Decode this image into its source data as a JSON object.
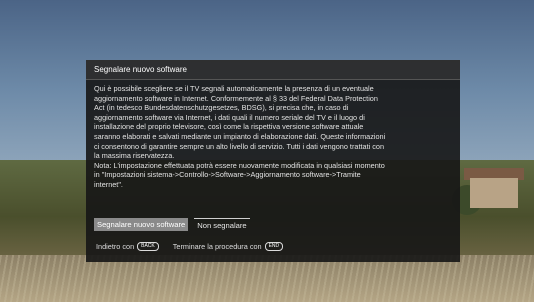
{
  "dialog": {
    "title": "Segnalare nuovo software",
    "body_lines": [
      "Qui è possibile scegliere se il TV segnali automaticamente la presenza di un eventuale",
      "aggiornamento software in Internet. Conformemente al § 33 del Federal Data Protection",
      "Act (in tedesco Bundesdatenschutzgesetzes, BDSG), si precisa che, in caso di",
      "aggiornamento software via Internet, i dati quali il numero seriale del TV e il luogo di",
      "installazione del proprio televisore, così come la rispettiva versione software attuale",
      "saranno elaborati e salvati mediante un impianto di elaborazione dati. Queste informazioni",
      "ci consentono di garantire sempre un alto livello di servizio. Tutti i dati vengono trattati con",
      "la massima riservatezza.",
      "Nota: L'impostazione effettuata potrà essere nuovamente modificata in qualsiasi momento",
      "in \"Impostazioni sistema->Controllo->Software->Aggiornamento software->Tramite",
      "internet\"."
    ],
    "buttons": {
      "report": "Segnalare nuovo software",
      "dont_report": "Non segnalare"
    },
    "footer": {
      "back_label": "Indietro con",
      "back_key": "BACK",
      "end_label": "Terminare la procedura con",
      "end_key": "END"
    }
  },
  "colors": {
    "dialog_bg": "#161616",
    "selected_button": "#8a8a8a"
  }
}
